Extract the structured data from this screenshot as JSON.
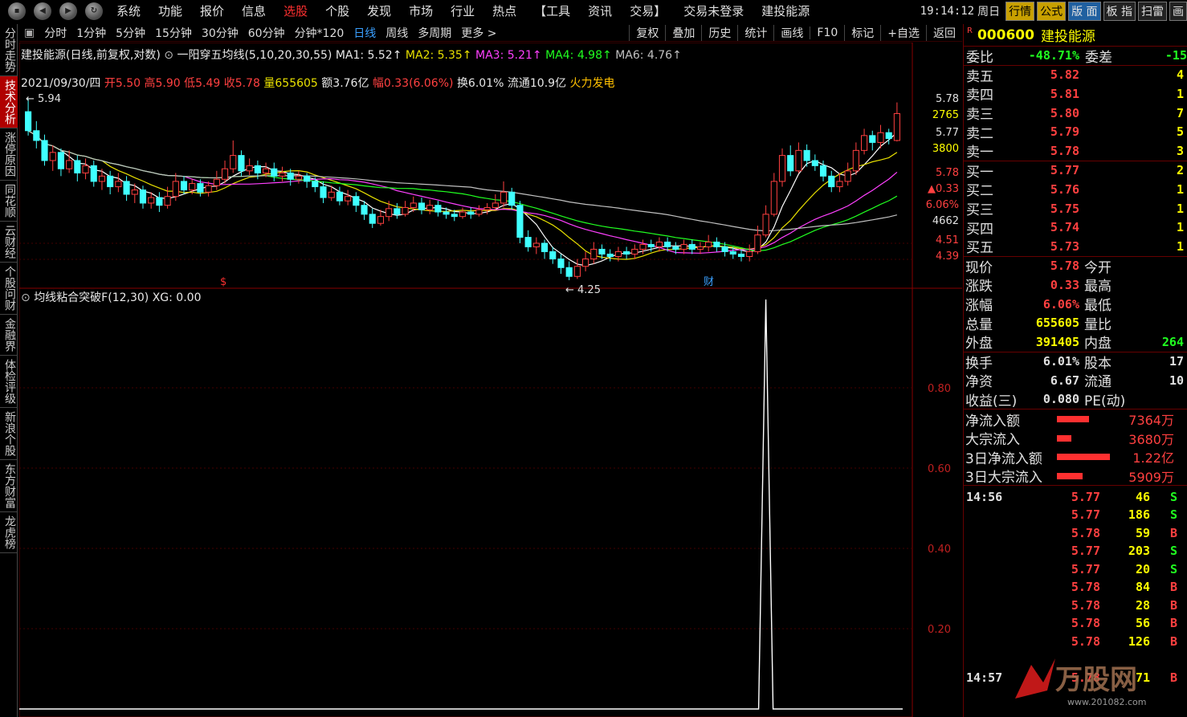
{
  "menubar": {
    "items": [
      "系统",
      "功能",
      "报价",
      "信息",
      "选股",
      "个股",
      "发现",
      "市场",
      "行业",
      "热点",
      "【工具",
      "资讯",
      "交易】",
      "交易未登录",
      "建投能源"
    ],
    "active_index": 4,
    "clock": "19:14:12",
    "weekday": "周日",
    "buttons": [
      "行情",
      "公式",
      "版 面",
      "板 指",
      "扫雷",
      "画"
    ]
  },
  "left_tabs": [
    "分时走势",
    "技术分析",
    "涨停原因",
    "同花顺",
    "云财经",
    "个股问财",
    "金融界",
    "体检评级",
    "新浪个股",
    "东方财富",
    "龙虎榜"
  ],
  "left_tabs_active": 1,
  "period_bar": {
    "items": [
      "分时",
      "1分钟",
      "5分钟",
      "15分钟",
      "30分钟",
      "60分钟",
      "分钟*120",
      "日线",
      "周线",
      "多周期",
      "更多 >"
    ],
    "active_index": 7,
    "right_buttons": [
      "复权",
      "叠加",
      "历史",
      "统计",
      "画线",
      "F10",
      "标记",
      "+自选",
      "返回"
    ]
  },
  "legend": {
    "title": "建投能源(日线,前复权,对数)",
    "indicator": "一阳穿五均线(5,10,20,30,55)",
    "ma1": "MA1: 5.52↑",
    "ma2": "MA2: 5.35↑",
    "ma3": "MA3: 5.21↑",
    "ma4": "MA4: 4.98↑",
    "ma6": "MA6: 4.76↑"
  },
  "bar_info": {
    "date": "2021/09/30/四",
    "open": "开5.50",
    "high": "高5.90",
    "low": "低5.49",
    "close": "收5.78",
    "vol": "量655605",
    "amount": "额3.76亿",
    "range": "幅0.33(6.06%)",
    "turnover": "换6.01%",
    "float": "流通10.9亿",
    "concept": "火力发电"
  },
  "price_axis": {
    "high_label": "5.94",
    "low_label": "4.25",
    "ticks": [
      "5.78",
      "2765",
      "5.77",
      "3800",
      "5.78",
      "▲0.33",
      "6.06%",
      "4662",
      "4.51",
      "4.39"
    ]
  },
  "sub_indicator": {
    "title": "均线粘合突破F(12,30)",
    "value": "XG: 0.00",
    "ticks": [
      "0.80",
      "0.60",
      "0.40",
      "0.20"
    ]
  },
  "markers": {
    "dollar": "$",
    "cai": "财"
  },
  "quote": {
    "r_tag": "R",
    "code": "000600",
    "name": "建投能源",
    "weibi_label": "委比",
    "weibi": "-48.71%",
    "weicha_label": "委差",
    "weicha": "-15",
    "asks": [
      {
        "label": "卖五",
        "price": "5.82",
        "vol": "4"
      },
      {
        "label": "卖四",
        "price": "5.81",
        "vol": "1"
      },
      {
        "label": "卖三",
        "price": "5.80",
        "vol": "7"
      },
      {
        "label": "卖二",
        "price": "5.79",
        "vol": "5"
      },
      {
        "label": "卖一",
        "price": "5.78",
        "vol": "3"
      }
    ],
    "bids": [
      {
        "label": "买一",
        "price": "5.77",
        "vol": "2"
      },
      {
        "label": "买二",
        "price": "5.76",
        "vol": "1"
      },
      {
        "label": "买三",
        "price": "5.75",
        "vol": "1"
      },
      {
        "label": "买四",
        "price": "5.74",
        "vol": "1"
      },
      {
        "label": "买五",
        "price": "5.73",
        "vol": "1"
      }
    ],
    "stats": [
      {
        "l1": "现价",
        "v1": "5.78",
        "l2": "今开"
      },
      {
        "l1": "涨跌",
        "v1": "0.33",
        "l2": "最高"
      },
      {
        "l1": "涨幅",
        "v1": "6.06%",
        "l2": "最低"
      },
      {
        "l1": "总量",
        "v1": "655605",
        "l2": "量比"
      },
      {
        "l1": "外盘",
        "v1": "391405",
        "l2": "内盘",
        "v2": "264"
      }
    ],
    "fund": [
      {
        "l1": "换手",
        "v1": "6.01%",
        "l2": "股本",
        "v2": "17"
      },
      {
        "l1": "净资",
        "v1": "6.67",
        "l2": "流通",
        "v2": "10"
      },
      {
        "l1": "收益(三)",
        "v1": "0.080",
        "l2": "PE(动)",
        "v2": ""
      }
    ],
    "flows": [
      {
        "label": "净流入额",
        "bar": 40,
        "value": "7364万"
      },
      {
        "label": "大宗流入",
        "bar": 18,
        "value": "3680万"
      },
      {
        "label": "3日净流入额",
        "bar": 66,
        "value": "1.22亿"
      },
      {
        "label": "3日大宗流入",
        "bar": 32,
        "value": "5909万"
      }
    ],
    "ticks": [
      {
        "time": "14:56",
        "price": "5.77",
        "vol": "46",
        "dir": "S"
      },
      {
        "time": "",
        "price": "5.77",
        "vol": "186",
        "dir": "S"
      },
      {
        "time": "",
        "price": "5.78",
        "vol": "59",
        "dir": "B"
      },
      {
        "time": "",
        "price": "5.77",
        "vol": "203",
        "dir": "S"
      },
      {
        "time": "",
        "price": "5.77",
        "vol": "20",
        "dir": "S"
      },
      {
        "time": "",
        "price": "5.78",
        "vol": "84",
        "dir": "B"
      },
      {
        "time": "",
        "price": "5.78",
        "vol": "28",
        "dir": "B"
      },
      {
        "time": "",
        "price": "5.78",
        "vol": "56",
        "dir": "B"
      },
      {
        "time": "",
        "price": "5.78",
        "vol": "126",
        "dir": "B"
      },
      {
        "time": "",
        "price": "",
        "vol": "",
        "dir": ""
      },
      {
        "time": "14:57",
        "price": "5.78",
        "vol": "71",
        "dir": "B"
      }
    ]
  },
  "watermark": {
    "text": "万股网",
    "url": "www.201082.com"
  },
  "colors": {
    "up": "#ff4040",
    "down": "#40ffff",
    "ma1": "#ffffff",
    "ma2": "#e8e000",
    "ma3": "#ff40ff",
    "ma4": "#20ff20",
    "ma6": "#c0c0c0"
  },
  "chart_data": {
    "type": "candlestick",
    "price_range": [
      4.25,
      5.94
    ],
    "candles": [
      [
        5.8,
        5.6,
        5.94,
        5.55
      ],
      [
        5.6,
        5.5,
        5.7,
        5.42
      ],
      [
        5.5,
        5.3,
        5.56,
        5.25
      ],
      [
        5.3,
        5.38,
        5.45,
        5.2
      ],
      [
        5.38,
        5.22,
        5.42,
        5.15
      ],
      [
        5.22,
        5.3,
        5.4,
        5.18
      ],
      [
        5.3,
        5.18,
        5.35,
        5.1
      ],
      [
        5.18,
        5.25,
        5.32,
        5.12
      ],
      [
        5.25,
        5.1,
        5.3,
        5.05
      ],
      [
        5.1,
        5.15,
        5.22,
        5.02
      ],
      [
        5.15,
        5.05,
        5.2,
        4.98
      ],
      [
        5.05,
        5.1,
        5.18,
        5.0
      ],
      [
        5.1,
        4.98,
        5.15,
        4.92
      ],
      [
        4.98,
        5.02,
        5.08,
        4.9
      ],
      [
        5.02,
        4.9,
        5.06,
        4.85
      ],
      [
        4.9,
        4.95,
        5.0,
        4.85
      ],
      [
        4.95,
        4.88,
        5.0,
        4.82
      ],
      [
        4.88,
        4.96,
        5.05,
        4.85
      ],
      [
        4.96,
        5.1,
        5.18,
        4.92
      ],
      [
        5.1,
        5.02,
        5.15,
        4.98
      ],
      [
        5.02,
        5.08,
        5.12,
        4.98
      ],
      [
        5.08,
        5.0,
        5.12,
        4.96
      ],
      [
        5.0,
        5.06,
        5.1,
        4.96
      ],
      [
        5.06,
        5.12,
        5.2,
        5.02
      ],
      [
        5.12,
        5.22,
        5.3,
        5.08
      ],
      [
        5.22,
        5.35,
        5.5,
        5.18
      ],
      [
        5.35,
        5.2,
        5.4,
        5.15
      ],
      [
        5.2,
        5.25,
        5.32,
        5.16
      ],
      [
        5.25,
        5.18,
        5.3,
        5.12
      ],
      [
        5.18,
        5.22,
        5.28,
        5.14
      ],
      [
        5.22,
        5.15,
        5.28,
        5.1
      ],
      [
        5.15,
        5.18,
        5.24,
        5.1
      ],
      [
        5.18,
        5.12,
        5.22,
        5.06
      ],
      [
        5.12,
        5.15,
        5.2,
        5.08
      ],
      [
        5.15,
        5.1,
        5.18,
        5.04
      ],
      [
        5.1,
        5.05,
        5.14,
        5.0
      ],
      [
        5.05,
        4.95,
        5.1,
        4.9
      ],
      [
        4.95,
        5.0,
        5.06,
        4.92
      ],
      [
        5.0,
        4.92,
        5.05,
        4.88
      ],
      [
        4.92,
        4.96,
        5.02,
        4.88
      ],
      [
        4.96,
        4.88,
        5.0,
        4.82
      ],
      [
        4.88,
        4.8,
        4.92,
        4.75
      ],
      [
        4.8,
        4.72,
        4.85,
        4.68
      ],
      [
        4.72,
        4.78,
        4.84,
        4.7
      ],
      [
        4.78,
        4.85,
        4.92,
        4.74
      ],
      [
        4.85,
        4.8,
        4.9,
        4.76
      ],
      [
        4.8,
        4.86,
        4.92,
        4.78
      ],
      [
        4.86,
        4.9,
        4.96,
        4.82
      ],
      [
        4.9,
        4.84,
        4.95,
        4.8
      ],
      [
        4.84,
        4.88,
        4.93,
        4.8
      ],
      [
        4.88,
        4.82,
        4.92,
        4.78
      ],
      [
        4.82,
        4.8,
        4.86,
        4.76
      ],
      [
        4.8,
        4.78,
        4.84,
        4.74
      ],
      [
        4.78,
        4.82,
        4.86,
        4.76
      ],
      [
        4.82,
        4.8,
        4.86,
        4.76
      ],
      [
        4.8,
        4.84,
        4.88,
        4.78
      ],
      [
        4.84,
        4.86,
        4.9,
        4.8
      ],
      [
        4.86,
        4.9,
        4.98,
        4.84
      ],
      [
        4.9,
        5.0,
        5.1,
        4.86
      ],
      [
        5.0,
        4.88,
        5.04,
        4.84
      ],
      [
        4.88,
        4.6,
        4.92,
        4.55
      ],
      [
        4.6,
        4.52,
        4.66,
        4.48
      ],
      [
        4.52,
        4.55,
        4.6,
        4.46
      ],
      [
        4.55,
        4.48,
        4.58,
        4.42
      ],
      [
        4.48,
        4.42,
        4.52,
        4.38
      ],
      [
        4.42,
        4.35,
        4.46,
        4.3
      ],
      [
        4.35,
        4.28,
        4.4,
        4.25
      ],
      [
        4.28,
        4.36,
        4.42,
        4.26
      ],
      [
        4.36,
        4.42,
        4.48,
        4.32
      ],
      [
        4.42,
        4.5,
        4.56,
        4.38
      ],
      [
        4.5,
        4.46,
        4.54,
        4.42
      ],
      [
        4.46,
        4.44,
        4.5,
        4.4
      ],
      [
        4.44,
        4.48,
        4.52,
        4.4
      ],
      [
        4.48,
        4.46,
        4.52,
        4.42
      ],
      [
        4.46,
        4.5,
        4.54,
        4.42
      ],
      [
        4.5,
        4.54,
        4.58,
        4.46
      ],
      [
        4.54,
        4.52,
        4.58,
        4.48
      ],
      [
        4.52,
        4.56,
        4.6,
        4.48
      ],
      [
        4.56,
        4.52,
        4.6,
        4.48
      ],
      [
        4.52,
        4.5,
        4.56,
        4.46
      ],
      [
        4.5,
        4.54,
        4.58,
        4.46
      ],
      [
        4.54,
        4.5,
        4.58,
        4.46
      ],
      [
        4.5,
        4.52,
        4.56,
        4.46
      ],
      [
        4.52,
        4.56,
        4.62,
        4.48
      ],
      [
        4.56,
        4.52,
        4.6,
        4.48
      ],
      [
        4.52,
        4.48,
        4.56,
        4.44
      ],
      [
        4.48,
        4.46,
        4.52,
        4.42
      ],
      [
        4.46,
        4.44,
        4.5,
        4.4
      ],
      [
        4.44,
        4.48,
        4.54,
        4.4
      ],
      [
        4.48,
        4.62,
        4.7,
        4.46
      ],
      [
        4.62,
        4.8,
        4.88,
        4.6
      ],
      [
        4.8,
        5.1,
        5.18,
        4.78
      ],
      [
        5.1,
        5.35,
        5.42,
        5.05
      ],
      [
        5.35,
        5.2,
        5.45,
        5.15
      ],
      [
        5.2,
        5.4,
        5.48,
        5.18
      ],
      [
        5.4,
        5.3,
        5.46,
        5.24
      ],
      [
        5.3,
        5.25,
        5.36,
        5.2
      ],
      [
        5.25,
        5.15,
        5.3,
        5.1
      ],
      [
        5.15,
        5.05,
        5.2,
        5.0
      ],
      [
        5.05,
        5.1,
        5.18,
        5.0
      ],
      [
        5.1,
        5.2,
        5.28,
        5.06
      ],
      [
        5.2,
        5.4,
        5.48,
        5.16
      ],
      [
        5.4,
        5.55,
        5.62,
        5.36
      ],
      [
        5.55,
        5.48,
        5.6,
        5.4
      ],
      [
        5.48,
        5.58,
        5.66,
        5.42
      ],
      [
        5.58,
        5.52,
        5.62,
        5.46
      ],
      [
        5.5,
        5.78,
        5.9,
        5.49
      ]
    ],
    "ma_series": [
      "MA1",
      "MA2",
      "MA3",
      "MA4",
      "MA6"
    ],
    "sub_values": {
      "x_spike_index": 90,
      "y_range": [
        0,
        1
      ],
      "spike_value": 1.0
    }
  }
}
